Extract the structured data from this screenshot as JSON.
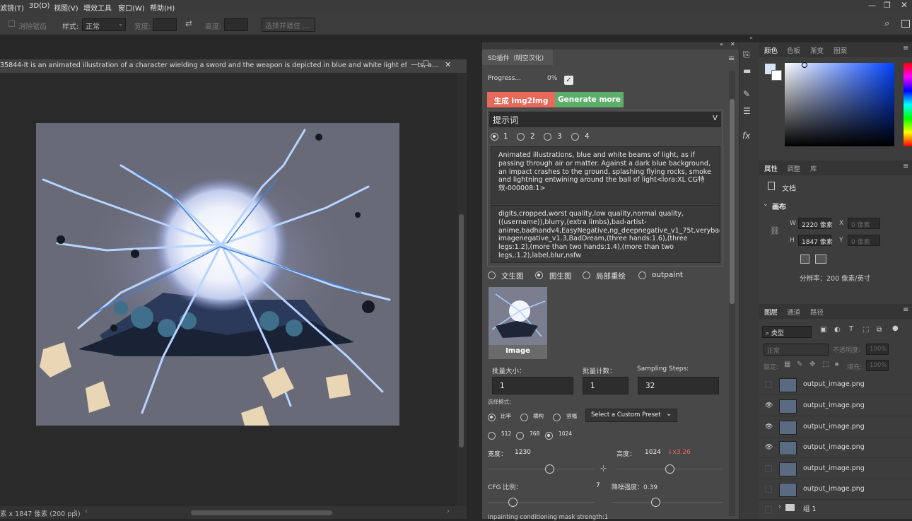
{
  "menu": [
    "滤镜(T)",
    "3D(D)",
    "视图(V)",
    "增效工具",
    "窗口(W)",
    "帮助(H)"
  ],
  "options": {
    "antialias": "消除锯齿",
    "style_label": "样式:",
    "style_value": "正常",
    "width_label": "宽度:",
    "height_label": "高度:",
    "select_mask": "选择并遮住 ..."
  },
  "document": {
    "title": "35844-It is an animated illustration of a character wielding a sword and the weapon is depicted in blue and white light effects, a...",
    "status": "素 x 1847 像素 (200 ppi)"
  },
  "plugin": {
    "tab": "SD插件（明空汉化)",
    "progress_label": "Progress...",
    "progress_value": "0%",
    "btn_generate": "生成 Img2Img",
    "btn_more": "Generate more",
    "prompt_header": "提示词",
    "prompt_header_toggle": "V",
    "prompt_slots": [
      "1",
      "2",
      "3",
      "4"
    ],
    "positive_prompt": "Animated illustrations, blue and white beams of light, as if passing through air or matter. Against a dark blue background, an impact crashes to the ground, splashing flying rocks, smoke and lightning entwining around the ball of light<lora:XL CG特效-000008:1>",
    "negative_prompt": "digits,cropped,worst quality,low quality,normal quality,((username)),blurry,(extra limbs),bad-artist-anime,badhandv4,EasyNegative,ng_deepnegative_v1_75t,verybad imagenegative_v1.3,BadDream,(three hands:1.6),(three legs:1.2),(more than two hands:1.4),(more than two legs,:1.2),label,blur,nsfw",
    "modes": [
      "文生图",
      "图生图",
      "局部重绘",
      "outpaint"
    ],
    "image_label": "Image",
    "batch_size_label": "批量大小：",
    "batch_size": "1",
    "batch_count_label": "批量计数：",
    "batch_count": "1",
    "steps_label": "Sampling Steps:",
    "steps": "32",
    "select_mode_label": "选择模式：",
    "ratio_opts": [
      "比率",
      "横构",
      "竖幅"
    ],
    "preset": "Select a Custom Preset",
    "res_opts": [
      "512",
      "768",
      "1024"
    ],
    "width_label": "宽度：",
    "width": "1230",
    "height_label": "高度：",
    "height": "1024",
    "scale": "↓x3.26",
    "cfg_label": "CFG 比例：",
    "cfg": "7",
    "denoise_label": "降噪强度：0.39",
    "inpaint_label": "Inpainting conditioning mask strength:1"
  },
  "color_panel": {
    "tabs": [
      "颜色",
      "色板",
      "渐变",
      "图案"
    ]
  },
  "properties": {
    "tabs": [
      "属性",
      "调整",
      "库"
    ],
    "doc": "文档",
    "canvas": "画布",
    "w_label": "W",
    "w_val": "2220 像素",
    "x_label": "X",
    "x_ph": "0 像素",
    "h_label": "H",
    "h_val": "1847 像素",
    "y_label": "Y",
    "y_ph": "0 像素",
    "resolution": "分辨率：200 像素/英寸"
  },
  "layers": {
    "tabs": [
      "图层",
      "通道",
      "路径"
    ],
    "kind": "类型",
    "blend": "正常",
    "opacity_label": "不透明度:",
    "opacity": "100%",
    "lock_label": "锁定:",
    "fill_label": "填充:",
    "fill": "100%",
    "items": [
      {
        "name": "output_image.png",
        "visible": false
      },
      {
        "name": "output_image.png",
        "visible": true
      },
      {
        "name": "output_image.png",
        "visible": true
      },
      {
        "name": "output_image.png",
        "visible": true
      },
      {
        "name": "output_image.png",
        "visible": false
      },
      {
        "name": "output_image.png",
        "visible": false
      }
    ],
    "group": "组 1"
  },
  "colors": {
    "generate": "#e8685a",
    "more": "#5cae6a",
    "accent": "#1473e6"
  }
}
